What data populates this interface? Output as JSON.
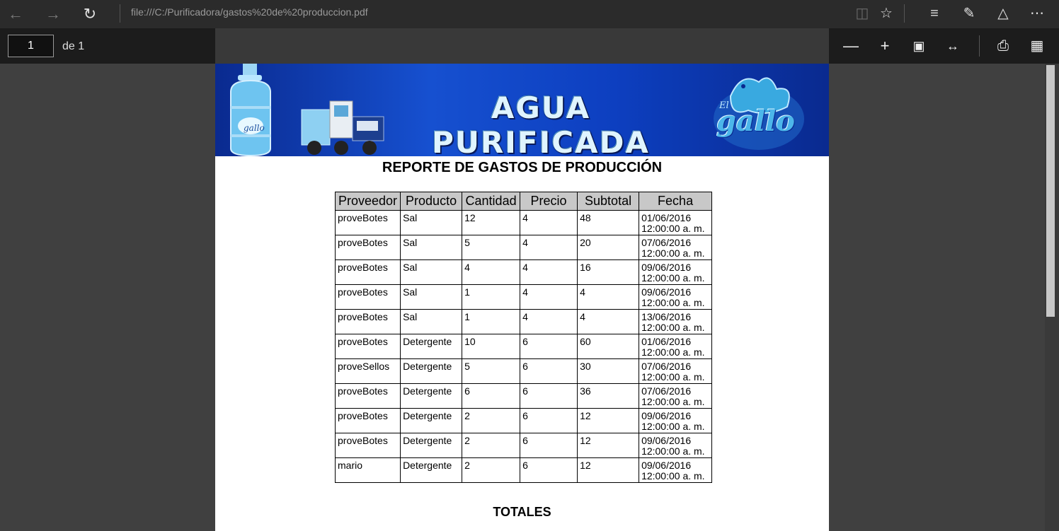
{
  "browser": {
    "url": "file:///C:/Purificadora/gastos%20de%20produccion.pdf"
  },
  "pdf_toolbar": {
    "page_number": "1",
    "page_of": "de 1"
  },
  "banner": {
    "title": "AGUA PURIFICADA",
    "bottle_brand": "gallo",
    "logo_small": "El",
    "logo_big": "gallo"
  },
  "report": {
    "title": "REPORTE DE GASTOS DE PRODUCCIÓN",
    "columns": [
      "Proveedor",
      "Producto",
      "Cantidad",
      "Precio",
      "Subtotal",
      "Fecha"
    ],
    "rows": [
      [
        "proveBotes",
        "Sal",
        "12",
        "4",
        "48",
        "01/06/2016",
        "12:00:00 a. m."
      ],
      [
        "proveBotes",
        "Sal",
        "5",
        "4",
        "20",
        "07/06/2016",
        "12:00:00 a. m."
      ],
      [
        "proveBotes",
        "Sal",
        "4",
        "4",
        "16",
        "09/06/2016",
        "12:00:00 a. m."
      ],
      [
        "proveBotes",
        "Sal",
        "1",
        "4",
        "4",
        "09/06/2016",
        "12:00:00 a. m."
      ],
      [
        "proveBotes",
        "Sal",
        "1",
        "4",
        "4",
        "13/06/2016",
        "12:00:00 a. m."
      ],
      [
        "proveBotes",
        "Detergente",
        "10",
        "6",
        "60",
        "01/06/2016",
        "12:00:00 a. m."
      ],
      [
        "proveSellos",
        "Detergente",
        "5",
        "6",
        "30",
        "07/06/2016",
        "12:00:00 a. m."
      ],
      [
        "proveBotes",
        "Detergente",
        "6",
        "6",
        "36",
        "07/06/2016",
        "12:00:00 a. m."
      ],
      [
        "proveBotes",
        "Detergente",
        "2",
        "6",
        "12",
        "09/06/2016",
        "12:00:00 a. m."
      ],
      [
        "proveBotes",
        "Detergente",
        "2",
        "6",
        "12",
        "09/06/2016",
        "12:00:00 a. m."
      ],
      [
        "mario",
        "Detergente",
        "2",
        "6",
        "12",
        "09/06/2016",
        "12:00:00 a. m."
      ]
    ],
    "totals_heading": "TOTALES"
  }
}
